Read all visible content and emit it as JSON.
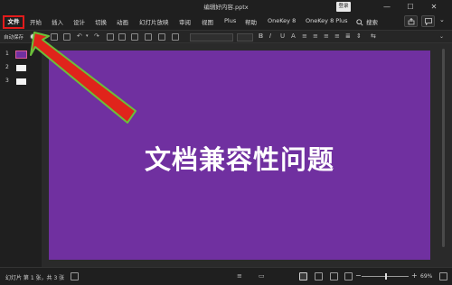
{
  "window": {
    "title": "编辑好内容.pptx",
    "login_label": "登录",
    "minimize": "—",
    "maximize": "☐",
    "close": "✕"
  },
  "ribbon": {
    "tabs": [
      {
        "label": "文件"
      },
      {
        "label": "开始"
      },
      {
        "label": "插入"
      },
      {
        "label": "设计"
      },
      {
        "label": "切换"
      },
      {
        "label": "动画"
      },
      {
        "label": "幻灯片放映"
      },
      {
        "label": "审阅"
      },
      {
        "label": "视图"
      },
      {
        "label": "Plus"
      },
      {
        "label": "帮助"
      },
      {
        "label": "OneKey 8"
      },
      {
        "label": "OneKey 8 Plus"
      },
      {
        "label": "搜索"
      }
    ]
  },
  "toolbar": {
    "autosave_label": "自动保存",
    "autosave_state": "off"
  },
  "thumbnails": {
    "slides": [
      {
        "number": "1",
        "active": true
      },
      {
        "number": "2",
        "active": false
      },
      {
        "number": "3",
        "active": false
      }
    ]
  },
  "slide": {
    "background_color": "#7030A0",
    "title": "文档兼容性问题"
  },
  "statusbar": {
    "slide_info": "幻灯片 第 1 张，共 3 张",
    "zoom_level": "69%",
    "zoom_fraction": 0.69
  },
  "colors": {
    "highlight_box": "#E21B1B",
    "arrow_fill": "#E0241B",
    "arrow_outline": "#6BBF3A"
  }
}
